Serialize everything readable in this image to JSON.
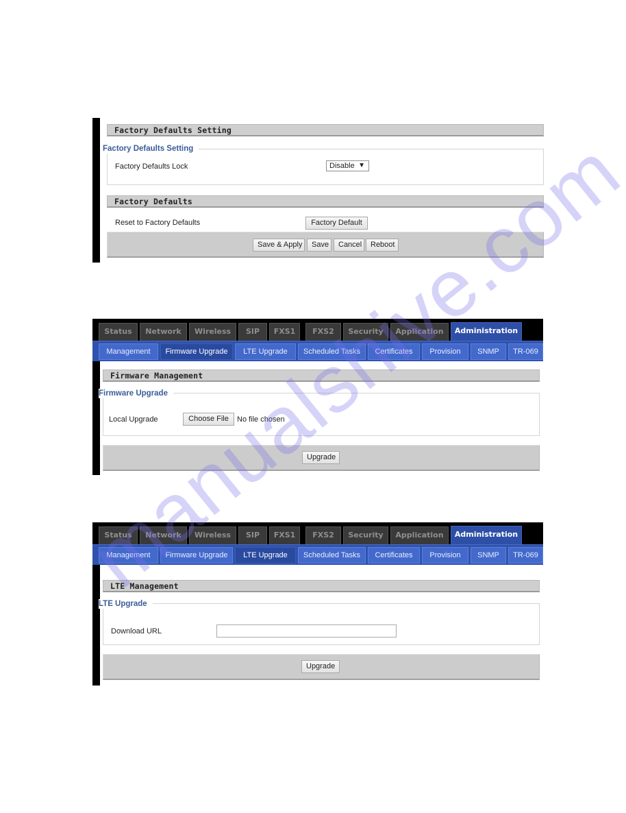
{
  "factory_panel": {
    "section_title": "Factory Defaults Setting",
    "fieldset_legend": "Factory Defaults Setting",
    "lock_label": "Factory Defaults Lock",
    "lock_value": "Disable",
    "lock_arrow": "▼",
    "defaults_section_title": "Factory Defaults",
    "reset_label": "Reset to Factory Defaults",
    "factory_default_button": "Factory Default",
    "actions": {
      "save_apply": "Save & Apply",
      "save": "Save",
      "cancel": "Cancel",
      "reboot": "Reboot"
    }
  },
  "main_tabs": [
    {
      "label": "Status",
      "active": false
    },
    {
      "label": "Network",
      "active": false
    },
    {
      "label": "Wireless",
      "active": false
    },
    {
      "label": "SIP",
      "active": false
    },
    {
      "label": "FXS1",
      "active": false
    },
    {
      "label": "FXS2",
      "active": false
    },
    {
      "label": "Security",
      "active": false
    },
    {
      "label": "Application",
      "active": false
    },
    {
      "label": "Administration",
      "active": true
    }
  ],
  "sub_tabs": [
    {
      "label": "Management"
    },
    {
      "label": "Firmware Upgrade"
    },
    {
      "label": "LTE Upgrade"
    },
    {
      "label": "Scheduled Tasks"
    },
    {
      "label": "Certificates"
    },
    {
      "label": "Provision"
    },
    {
      "label": "SNMP"
    },
    {
      "label": "TR-069"
    }
  ],
  "firmware_panel": {
    "active_subtab": "Firmware Upgrade",
    "section_title": "Firmware Management",
    "fieldset_legend": "Firmware Upgrade",
    "local_upgrade_label": "Local Upgrade",
    "choose_file_button": "Choose File",
    "file_status": "No file chosen",
    "upgrade_button": "Upgrade"
  },
  "lte_panel": {
    "active_subtab": "LTE Upgrade",
    "section_title": "LTE Management",
    "fieldset_legend": "LTE Upgrade",
    "download_url_label": "Download URL",
    "download_url_value": "",
    "upgrade_button": "Upgrade"
  },
  "watermark": "manualshive.com",
  "colors": {
    "active_tab": "#2e4fa8",
    "subtab": "#4369cc",
    "legend_text": "#3b5c99",
    "section_header": "#cfcfcf"
  }
}
